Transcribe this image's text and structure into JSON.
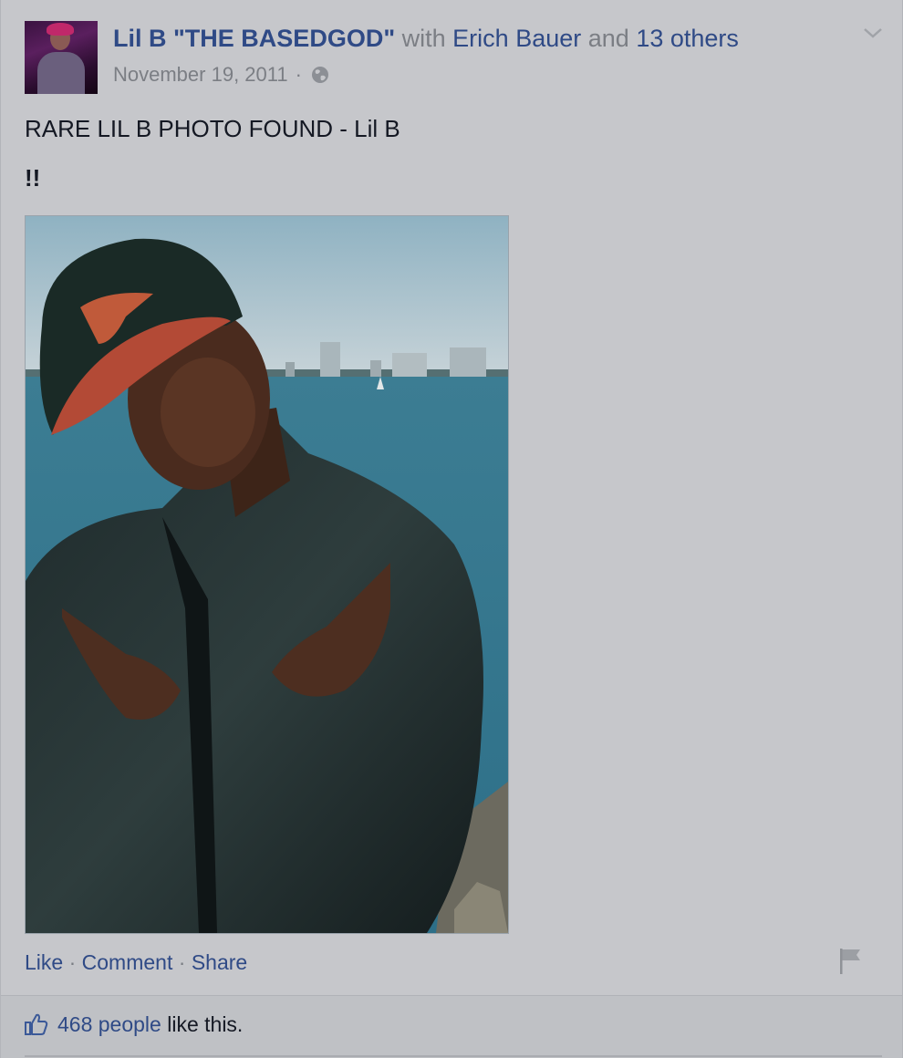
{
  "post": {
    "author": "Lil B \"THE BASEDGOD\"",
    "with_word": "with",
    "tagged_person": "Erich Bauer",
    "and_word": "and",
    "others_label": "13 others",
    "date": "November 19, 2011",
    "separator": "·",
    "privacy_icon": "globe-icon",
    "menu_icon": "chevron-down-icon",
    "text_line1": "RARE LIL B PHOTO FOUND - Lil B",
    "text_line2": "!!"
  },
  "actions": {
    "like": "Like",
    "comment": "Comment",
    "share": "Share",
    "sep": "·",
    "report_icon": "flag-icon"
  },
  "likes": {
    "count_label": "468 people",
    "suffix": "like this.",
    "icon": "thumbs-up-icon"
  },
  "colors": {
    "link": "#2f4a86",
    "meta": "#7b7e84",
    "background": "#c6c7cb"
  }
}
